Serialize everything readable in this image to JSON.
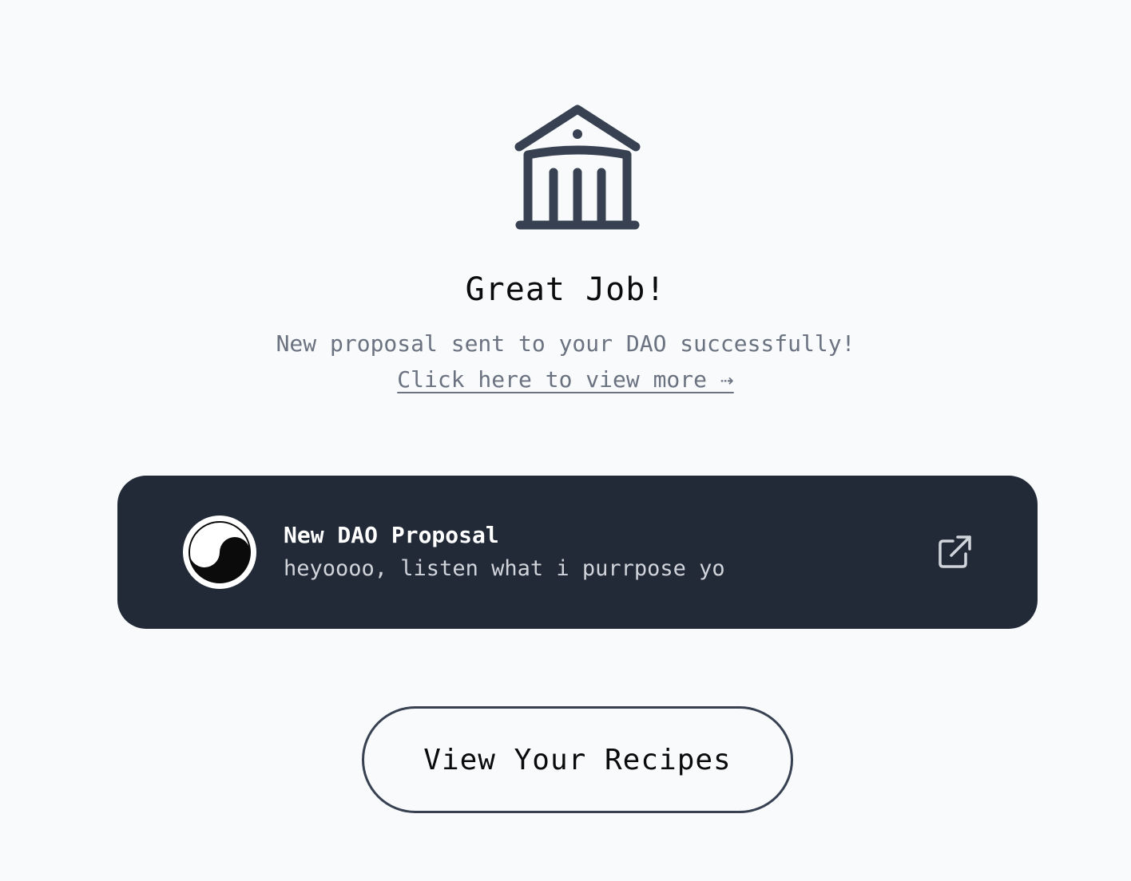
{
  "hero": {
    "icon": "bank-icon",
    "title": "Great Job!",
    "subtitle": "New proposal sent to your DAO successfully!",
    "link_label": "Click here to view more ⇢"
  },
  "proposal_card": {
    "avatar": "yin-yang-avatar",
    "title": "New DAO Proposal",
    "description": "heyoooo, listen what i purrpose yo",
    "action_icon": "external-link-icon"
  },
  "cta": {
    "label": "View Your Recipes"
  },
  "colors": {
    "background": "#f8fafc",
    "card_bg": "#222937",
    "icon_dark": "#374151",
    "muted_text": "#6b7280"
  }
}
